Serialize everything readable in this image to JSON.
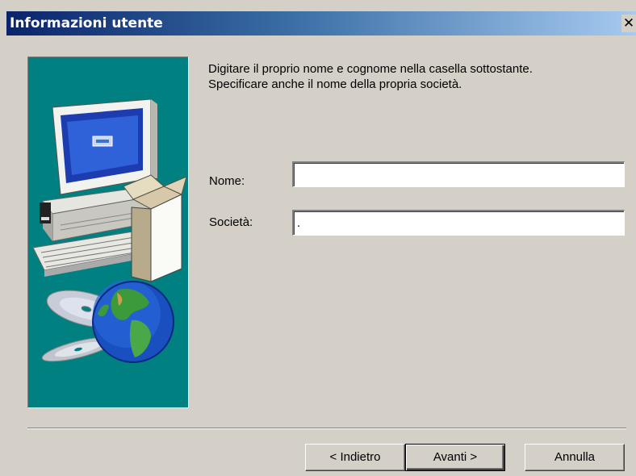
{
  "window": {
    "title": "Informazioni utente",
    "close_symbol": "✕"
  },
  "instructions": {
    "line1": "Digitare il proprio nome e cognome nella casella sottostante.",
    "line2": "Specificare anche il nome della propria società."
  },
  "form": {
    "name_label": "Nome:",
    "name_value": "",
    "company_label": "Società:",
    "company_value": "."
  },
  "buttons": {
    "back": "< Indietro",
    "next": "Avanti >",
    "cancel": "Annulla"
  },
  "illustration": {
    "icons": [
      "computer-icon",
      "box-icon",
      "cd-icon",
      "globe-icon"
    ],
    "background": "#008080"
  }
}
